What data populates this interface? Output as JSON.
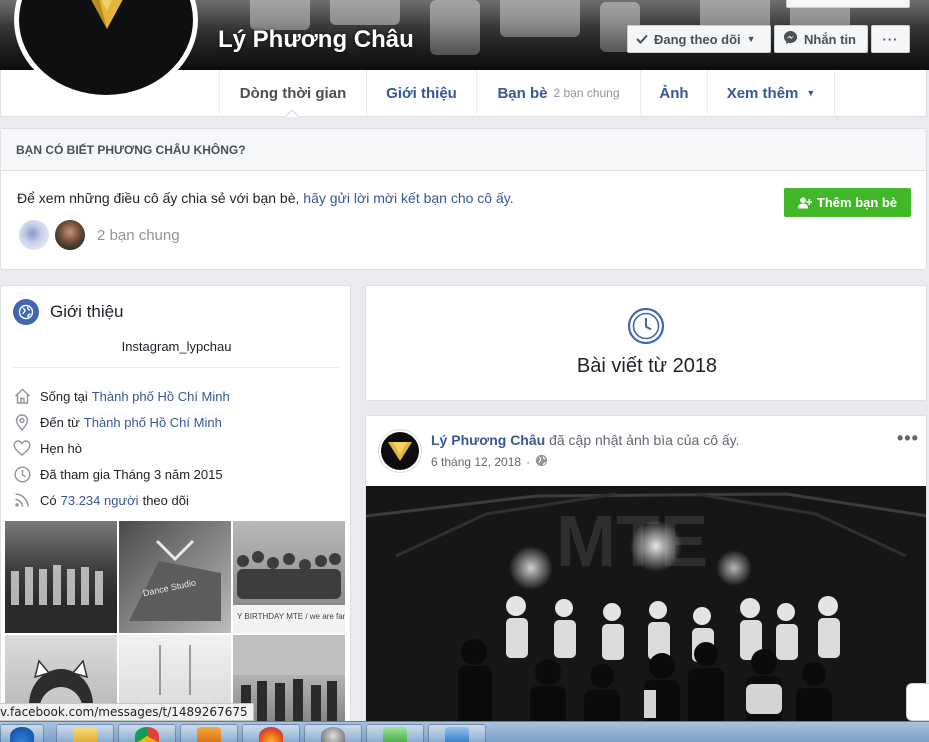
{
  "profile": {
    "name": "Lý Phương Châu",
    "actions": {
      "following": "Đang theo dõi",
      "message": "Nhắn tin",
      "more": "···"
    }
  },
  "tabs": [
    {
      "label": "Dòng thời gian",
      "sub": ""
    },
    {
      "label": "Giới thiệu",
      "sub": ""
    },
    {
      "label": "Bạn bè",
      "sub": "2 bạn chung"
    },
    {
      "label": "Ảnh",
      "sub": ""
    },
    {
      "label": "Xem thêm",
      "sub": ""
    }
  ],
  "know": {
    "heading": "BẠN CÓ BIẾT PHƯƠNG CHÂU KHÔNG?",
    "text": "Để xem những điều cô ấy chia sẻ với bạn bè,",
    "link": "hãy gửi lời mời kết bạn cho cô ấy.",
    "mutual": "2 bạn chung",
    "add_button": "Thêm bạn bè"
  },
  "intro": {
    "title": "Giới thiệu",
    "bio": "Instagram_lypchau",
    "rows": [
      {
        "icon": "home-icon",
        "prefix": "Sống tại",
        "link": "Thành phố Hồ Chí Minh",
        "suffix": ""
      },
      {
        "icon": "location-pin-icon",
        "prefix": "Đến từ",
        "link": "Thành phố Hồ Chí Minh",
        "suffix": ""
      },
      {
        "icon": "heart-icon",
        "prefix": "Hẹn hò",
        "link": "",
        "suffix": ""
      },
      {
        "icon": "clock-icon",
        "prefix": "Đã tham gia Tháng 3 năm 2015",
        "link": "",
        "suffix": ""
      },
      {
        "icon": "rss-icon",
        "prefix": "Có",
        "link": "73.234 người",
        "suffix": "theo dõi"
      }
    ],
    "photos": [
      {
        "caption": ""
      },
      {
        "caption": "Dance Studio"
      },
      {
        "caption": "Y BIRTHDAY MTE / we are family"
      },
      {
        "caption": ""
      },
      {
        "caption": ""
      },
      {
        "caption": ""
      }
    ]
  },
  "posts_from": {
    "label": "Bài viết từ 2018"
  },
  "post": {
    "author": "Lý Phương Châu",
    "action": "đã cập nhật ảnh bìa của cô ấy.",
    "date": "6 tháng 12, 2018",
    "more": "•••",
    "photo_text": "MTE"
  },
  "status_url": "v.facebook.com/messages/t/1489267675",
  "colors": {
    "link": "#365899",
    "green": "#42b72a",
    "brand_blue": "#4267b2",
    "background": "#e9ebee"
  },
  "taskbar": [
    "ie-icon",
    "folder-icon",
    "chrome-icon",
    "media-player-icon",
    "firefox-icon",
    "app-icon",
    "notes-icon",
    "window-icon"
  ]
}
